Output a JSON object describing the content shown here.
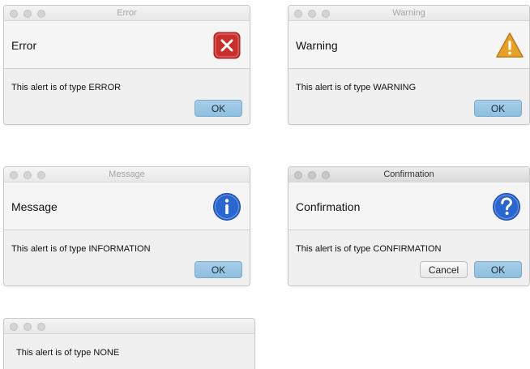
{
  "dialogs": {
    "error": {
      "window_title": "Error",
      "header": "Error",
      "content": "This alert is of type ERROR",
      "ok_label": "OK",
      "icon": "error-x-icon",
      "icon_color": "#c9302c"
    },
    "warning": {
      "window_title": "Warning",
      "header": "Warning",
      "content": "This alert is of type WARNING",
      "ok_label": "OK",
      "icon": "warning-triangle-icon",
      "icon_color": "#e8a126"
    },
    "information": {
      "window_title": "Message",
      "header": "Message",
      "content": "This alert is of type INFORMATION",
      "ok_label": "OK",
      "icon": "info-icon",
      "icon_color": "#2a66cf"
    },
    "confirmation": {
      "window_title": "Confirmation",
      "header": "Confirmation",
      "content": "This alert is of type CONFIRMATION",
      "cancel_label": "Cancel",
      "ok_label": "OK",
      "icon": "question-icon",
      "icon_color": "#2a66cf"
    },
    "none": {
      "content": "This alert is of type NONE"
    }
  },
  "colors": {
    "ok_button": "#9ac6e4",
    "window_bg": "#ececec"
  }
}
